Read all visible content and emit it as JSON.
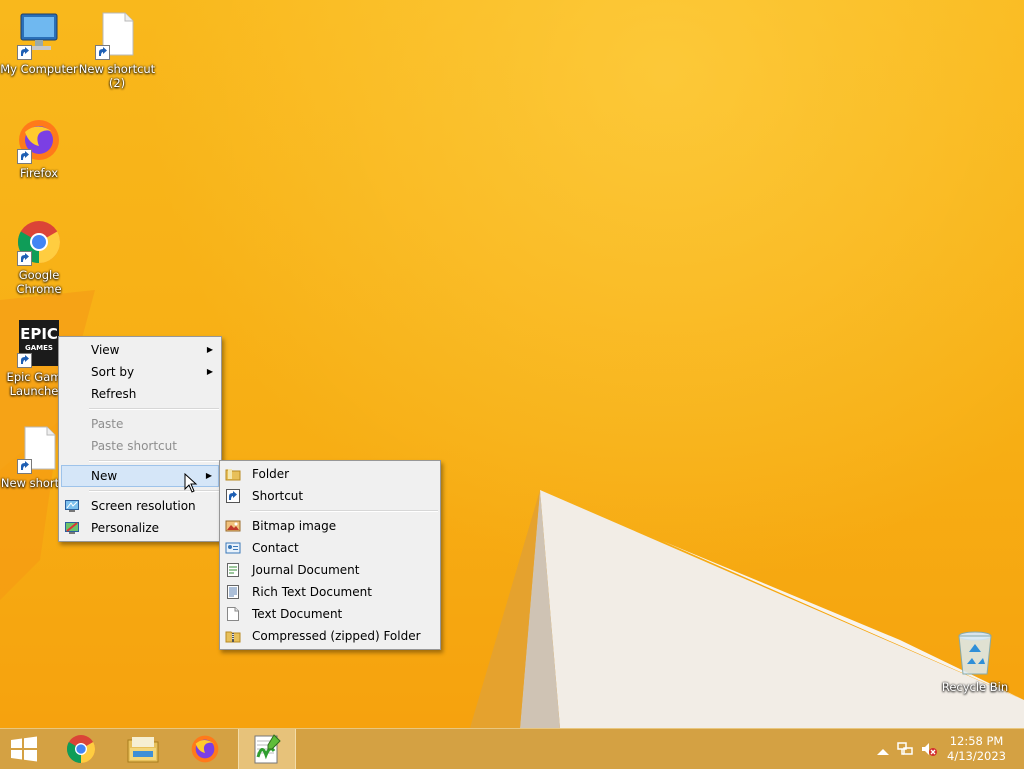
{
  "desktop": {
    "icons": [
      {
        "label": "My Computer"
      },
      {
        "label": "New shortcut (2)"
      },
      {
        "label": "Firefox"
      },
      {
        "label": "Google Chrome"
      },
      {
        "label": "Epic Games Launcher",
        "visible_label": "Epic Gam Launche",
        "logo_top": "EPIC",
        "logo_bottom": "GAMES"
      },
      {
        "label": "New shortcut",
        "visible_label": "New short"
      },
      {
        "label": "Recycle Bin"
      }
    ]
  },
  "context_menu": {
    "items": [
      {
        "label": "View",
        "submenu": true
      },
      {
        "label": "Sort by",
        "submenu": true
      },
      {
        "label": "Refresh"
      },
      {
        "label": "Paste",
        "disabled": true
      },
      {
        "label": "Paste shortcut",
        "disabled": true
      },
      {
        "label": "New",
        "submenu": true,
        "highlighted": true
      },
      {
        "label": "Screen resolution",
        "icon": "screen-resolution-icon"
      },
      {
        "label": "Personalize",
        "icon": "personalize-icon"
      }
    ]
  },
  "new_submenu": {
    "items": [
      {
        "label": "Folder",
        "icon": "folder-icon"
      },
      {
        "label": "Shortcut",
        "icon": "shortcut-icon"
      },
      {
        "label": "Bitmap image",
        "icon": "bitmap-icon"
      },
      {
        "label": "Contact",
        "icon": "contact-icon"
      },
      {
        "label": "Journal Document",
        "icon": "journal-icon"
      },
      {
        "label": "Rich Text Document",
        "icon": "rich-text-icon"
      },
      {
        "label": "Text Document",
        "icon": "text-document-icon"
      },
      {
        "label": "Compressed (zipped) Folder",
        "icon": "zip-folder-icon"
      }
    ]
  },
  "taskbar": {
    "apps": [
      "start-button",
      "chrome",
      "file-explorer",
      "firefox",
      "notepad-plus-plus"
    ],
    "active_app": "notepad-plus-plus",
    "clock": {
      "time": "12:58 PM",
      "date": "4/13/2023"
    }
  },
  "colors": {
    "wallpaper": "#f7b21a",
    "menu_bg": "#f0f0f0",
    "menu_highlight": "#d5e6f8"
  }
}
